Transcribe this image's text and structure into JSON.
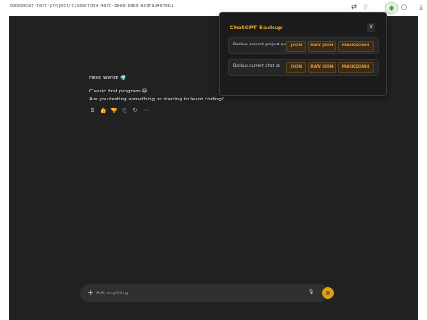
{
  "browser": {
    "url": "68b8d45af-test-project/c/68b7fd39-48fc-80e8-b86d-acdfa348f9b1"
  },
  "chat": {
    "greeting": "Hello world! 🌍",
    "program_line": "Classic first program 😄",
    "question": "Are you testing something or starting to learn coding?"
  },
  "popup": {
    "title": "ChatGPT Backup",
    "close": "X",
    "rows": [
      {
        "label": "Backup current project as",
        "buttons": [
          "JSON",
          "RAW JSON",
          "MARKDOWN"
        ]
      },
      {
        "label": "Backup current chat as",
        "buttons": [
          "JSON",
          "RAW JSON",
          "MARKDOWN"
        ]
      }
    ],
    "accent_color": "#e59a36"
  },
  "composer": {
    "placeholder": "Ask anything"
  }
}
